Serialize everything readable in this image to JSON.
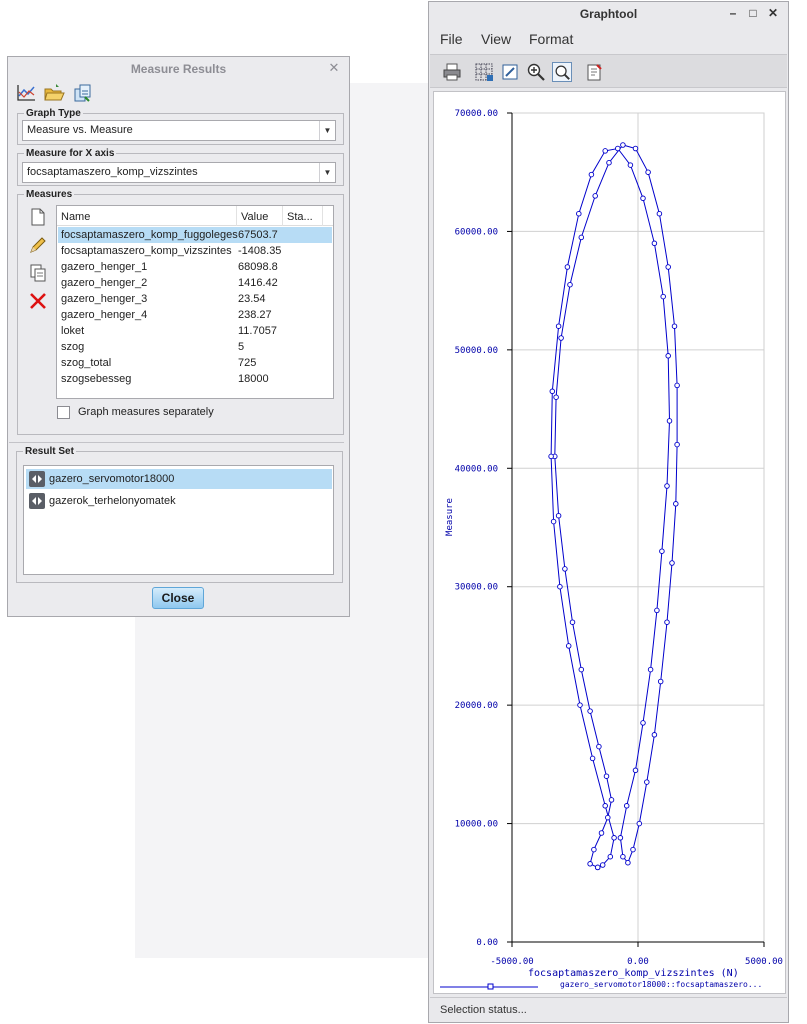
{
  "measure_dialog": {
    "title": "Measure Results",
    "graph_type_label": "Graph Type",
    "graph_type_value": "Measure vs. Measure",
    "x_axis_label": "Measure for X axis",
    "x_axis_value": "focsaptamaszero_komp_vizszintes",
    "measures_label": "Measures",
    "columns": [
      "Name",
      "Value",
      "Sta..."
    ],
    "rows": [
      {
        "name": "focsaptamaszero_komp_fuggoleges",
        "value": "67503.7"
      },
      {
        "name": "focsaptamaszero_komp_vizszintes",
        "value": "-1408.35"
      },
      {
        "name": "gazero_henger_1",
        "value": "68098.8"
      },
      {
        "name": "gazero_henger_2",
        "value": "1416.42"
      },
      {
        "name": "gazero_henger_3",
        "value": "23.54"
      },
      {
        "name": "gazero_henger_4",
        "value": "238.27"
      },
      {
        "name": "loket",
        "value": "11.7057"
      },
      {
        "name": "szog",
        "value": "5"
      },
      {
        "name": "szog_total",
        "value": "725"
      },
      {
        "name": "szogsebesseg",
        "value": "18000"
      }
    ],
    "selected_row": 0,
    "graph_separately_label": "Graph measures separately",
    "graph_separately_checked": false,
    "result_set_label": "Result Set",
    "result_sets": [
      "gazero_servomotor18000",
      "gazerok_terhelonyomatek"
    ],
    "selected_result_set": 0,
    "close_label": "Close",
    "close_icon": "✕"
  },
  "graphtool": {
    "title": "Graphtool",
    "window_buttons": {
      "minimize": "–",
      "maximize": "□",
      "close": "✕"
    },
    "menu": [
      "File",
      "View",
      "Format"
    ],
    "status_text": "Selection status...",
    "toolbar_icons": [
      "print-icon",
      "grid-icon",
      "edit-axes-icon",
      "zoom-in-icon",
      "zoom-fit-icon",
      "export-icon"
    ]
  },
  "chart_data": {
    "type": "line",
    "title": "",
    "xlabel": "focsaptamaszero_komp_vizszintes (N)",
    "ylabel": "Measure",
    "xlim": [
      -5000,
      5000
    ],
    "ylim": [
      0,
      70000
    ],
    "x_ticks": [
      "-5000.00",
      "0.00",
      "5000.00"
    ],
    "y_ticks": [
      "0.00",
      "10000.00",
      "20000.00",
      "30000.00",
      "40000.00",
      "50000.00",
      "60000.00",
      "70000.00"
    ],
    "grid": true,
    "legend": "gazero_servomotor18000::focsaptamaszero...",
    "series": [
      {
        "name": "gazero_servomotor18000::focsaptamaszero...",
        "color": "#0000cc",
        "points": [
          [
            -1600,
            6300
          ],
          [
            -1900,
            6600
          ],
          [
            -1750,
            7800
          ],
          [
            -1450,
            9200
          ],
          [
            -1200,
            10500
          ],
          [
            -1050,
            12000
          ],
          [
            -1250,
            14000
          ],
          [
            -1550,
            16500
          ],
          [
            -1900,
            19500
          ],
          [
            -2250,
            23000
          ],
          [
            -2600,
            27000
          ],
          [
            -2900,
            31500
          ],
          [
            -3150,
            36000
          ],
          [
            -3300,
            41000
          ],
          [
            -3250,
            46000
          ],
          [
            -3050,
            51000
          ],
          [
            -2700,
            55500
          ],
          [
            -2250,
            59500
          ],
          [
            -1700,
            63000
          ],
          [
            -1150,
            65800
          ],
          [
            -600,
            67300
          ],
          [
            -100,
            67000
          ],
          [
            400,
            65000
          ],
          [
            850,
            61500
          ],
          [
            1200,
            57000
          ],
          [
            1450,
            52000
          ],
          [
            1550,
            47000
          ],
          [
            1550,
            42000
          ],
          [
            1500,
            37000
          ],
          [
            1350,
            32000
          ],
          [
            1150,
            27000
          ],
          [
            900,
            22000
          ],
          [
            650,
            17500
          ],
          [
            350,
            13500
          ],
          [
            50,
            10000
          ],
          [
            -200,
            7800
          ],
          [
            -400,
            6700
          ],
          [
            -600,
            7200
          ],
          [
            -700,
            8800
          ],
          [
            -450,
            11500
          ],
          [
            -100,
            14500
          ],
          [
            200,
            18500
          ],
          [
            500,
            23000
          ],
          [
            750,
            28000
          ],
          [
            950,
            33000
          ],
          [
            1150,
            38500
          ],
          [
            1250,
            44000
          ],
          [
            1200,
            49500
          ],
          [
            1000,
            54500
          ],
          [
            650,
            59000
          ],
          [
            200,
            62800
          ],
          [
            -300,
            65600
          ],
          [
            -800,
            67000
          ],
          [
            -1300,
            66800
          ],
          [
            -1850,
            64800
          ],
          [
            -2350,
            61500
          ],
          [
            -2800,
            57000
          ],
          [
            -3150,
            52000
          ],
          [
            -3400,
            46500
          ],
          [
            -3450,
            41000
          ],
          [
            -3350,
            35500
          ],
          [
            -3100,
            30000
          ],
          [
            -2750,
            25000
          ],
          [
            -2300,
            20000
          ],
          [
            -1800,
            15500
          ],
          [
            -1300,
            11500
          ],
          [
            -950,
            8800
          ],
          [
            -1100,
            7200
          ],
          [
            -1400,
            6500
          ],
          [
            -1600,
            6300
          ]
        ]
      }
    ]
  }
}
